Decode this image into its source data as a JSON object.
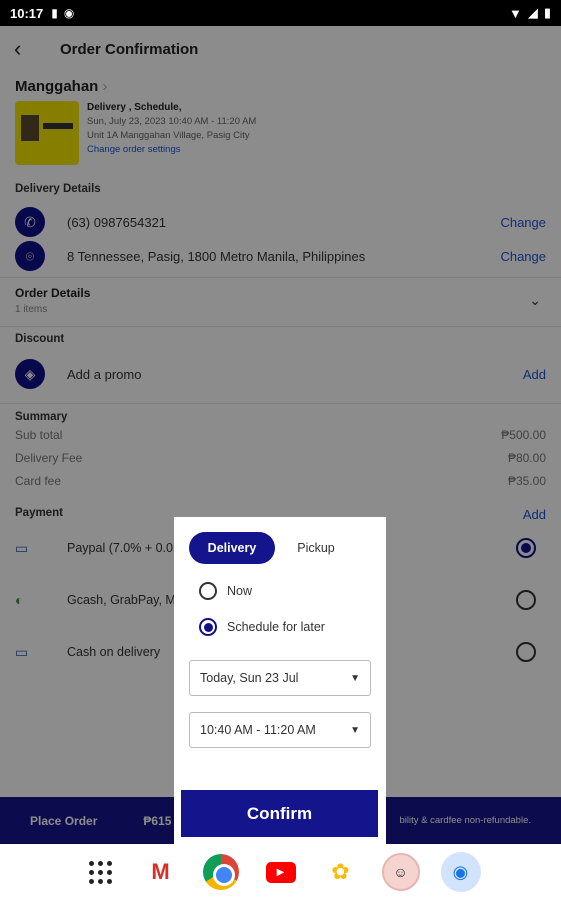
{
  "status": {
    "time": "10:17"
  },
  "header": {
    "title": "Order Confirmation"
  },
  "store": {
    "name": "Manggahan",
    "mode": "Delivery , Schedule,",
    "schedule": "Sun, July 23, 2023 10:40 AM - 11:20 AM",
    "address": "Unit 1A Manggahan Village, Pasig City",
    "change_link": "Change order settings"
  },
  "delivery": {
    "title": "Delivery Details",
    "phone": "(63) 0987654321",
    "address": "8 Tennessee, Pasig, 1800 Metro Manila, Philippines",
    "change_label": "Change"
  },
  "order_details": {
    "title": "Order Details",
    "count": "1 items"
  },
  "discount": {
    "title": "Discount",
    "placeholder": "Add a promo",
    "add_label": "Add"
  },
  "summary": {
    "title": "Summary",
    "rows": [
      {
        "label": "Sub total",
        "value": "₱500.00"
      },
      {
        "label": "Delivery Fee",
        "value": "₱80.00"
      },
      {
        "label": "Card fee",
        "value": "₱35.00"
      }
    ]
  },
  "payment": {
    "title": "Payment",
    "add_label": "Add",
    "options": [
      {
        "label": "Paypal (7.0% + 0.0",
        "icon": "card-icon",
        "selected": true
      },
      {
        "label": "Gcash, GrabPay, M",
        "icon": "gcash-icon",
        "selected": false
      },
      {
        "label": "Cash on delivery",
        "icon": "card-icon",
        "selected": false
      }
    ]
  },
  "bottom_bar": {
    "place_label": "Place Order",
    "price": "₱615",
    "note": "bility & cardfee non-refundable."
  },
  "modal": {
    "tabs": [
      "Delivery",
      "Pickup"
    ],
    "active_tab": "Delivery",
    "options": [
      "Now",
      "Schedule for later"
    ],
    "selected_option": "Schedule for later",
    "date": "Today, Sun 23 Jul",
    "time": "10:40 AM - 11:20 AM",
    "confirm_label": "Confirm"
  },
  "nav": {
    "yt_label": "▶"
  },
  "colors": {
    "primary": "#14148c",
    "link": "#1a56d6"
  }
}
